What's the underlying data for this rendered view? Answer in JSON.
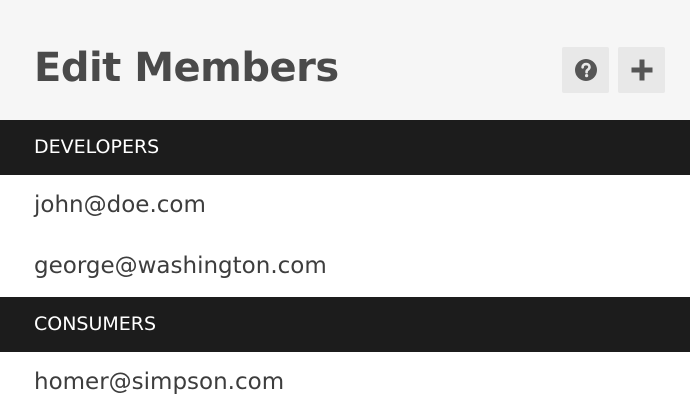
{
  "header": {
    "title": "Edit Members",
    "help_icon": "question-circle-icon",
    "add_icon": "plus-icon"
  },
  "groups": [
    {
      "name": "DEVELOPERS",
      "members": [
        "john@doe.com",
        "george@washington.com"
      ]
    },
    {
      "name": "CONSUMERS",
      "members": [
        "homer@simpson.com"
      ]
    }
  ],
  "colors": {
    "header_bg": "#f6f6f6",
    "group_bg": "#1c1c1c",
    "button_bg": "#e8e8e8",
    "icon": "#555555",
    "text": "#3d3d3d"
  }
}
